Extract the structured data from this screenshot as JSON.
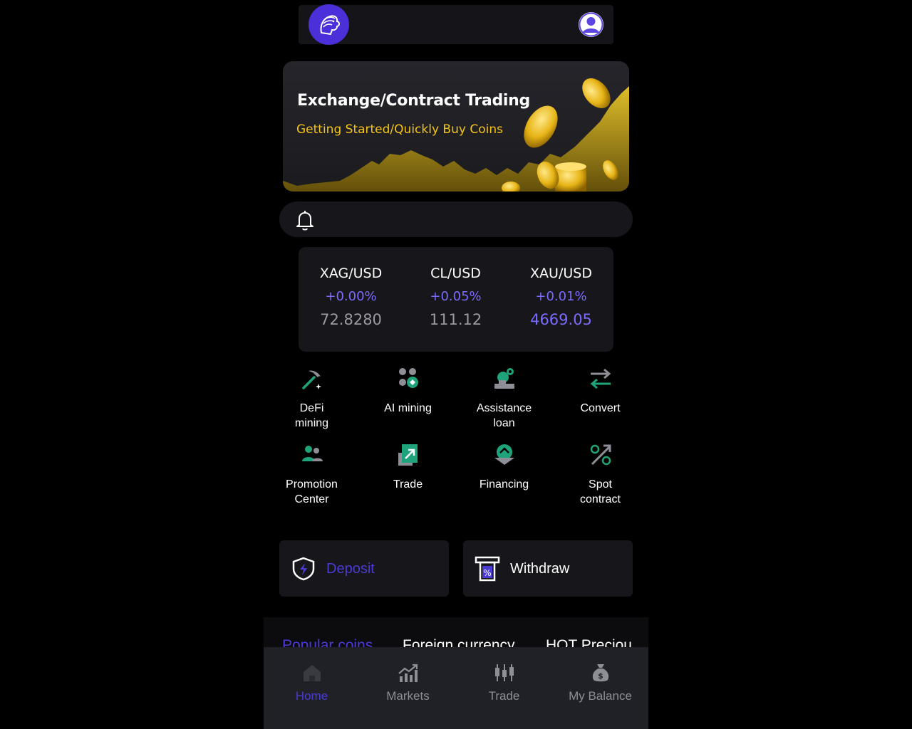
{
  "banner": {
    "title": "Exchange/Contract Trading",
    "subtitle": "Getting Started/Quickly Buy Coins"
  },
  "ticker": [
    {
      "symbol": "XAG/USD",
      "change": "+0.00%",
      "price": "72.8280"
    },
    {
      "symbol": "CL/USD",
      "change": "+0.05%",
      "price": "111.12"
    },
    {
      "symbol": "XAU/USD",
      "change": "+0.01%",
      "price": "4669.05"
    }
  ],
  "menu": [
    {
      "label": "DeFi\nmining",
      "icon": "pickaxe-icon"
    },
    {
      "label": "AI mining",
      "icon": "ai-mining-icon"
    },
    {
      "label": "Assistance\nloan",
      "icon": "loan-icon"
    },
    {
      "label": "Convert",
      "icon": "convert-arrows-icon"
    },
    {
      "label": "Promotion\nCenter",
      "icon": "users-icon"
    },
    {
      "label": "Trade",
      "icon": "trade-icon"
    },
    {
      "label": "Financing",
      "icon": "financing-icon"
    },
    {
      "label": "Spot\ncontract",
      "icon": "percent-arrow-icon"
    }
  ],
  "actions": {
    "deposit": "Deposit",
    "withdraw": "Withdraw"
  },
  "tabs": [
    "Popular coins",
    "Foreign currency",
    "HOT Preciou"
  ],
  "nav": [
    {
      "label": "Home",
      "icon": "home-icon",
      "active": true
    },
    {
      "label": "Markets",
      "icon": "markets-chart-icon",
      "active": false
    },
    {
      "label": "Trade",
      "icon": "candlestick-icon",
      "active": false
    },
    {
      "label": "My Balance",
      "icon": "money-bag-icon",
      "active": false
    }
  ],
  "colors": {
    "accent": "#4a3bd6",
    "up": "#7a6cff",
    "gold": "#f5c518",
    "icon_green": "#1fa37a"
  }
}
